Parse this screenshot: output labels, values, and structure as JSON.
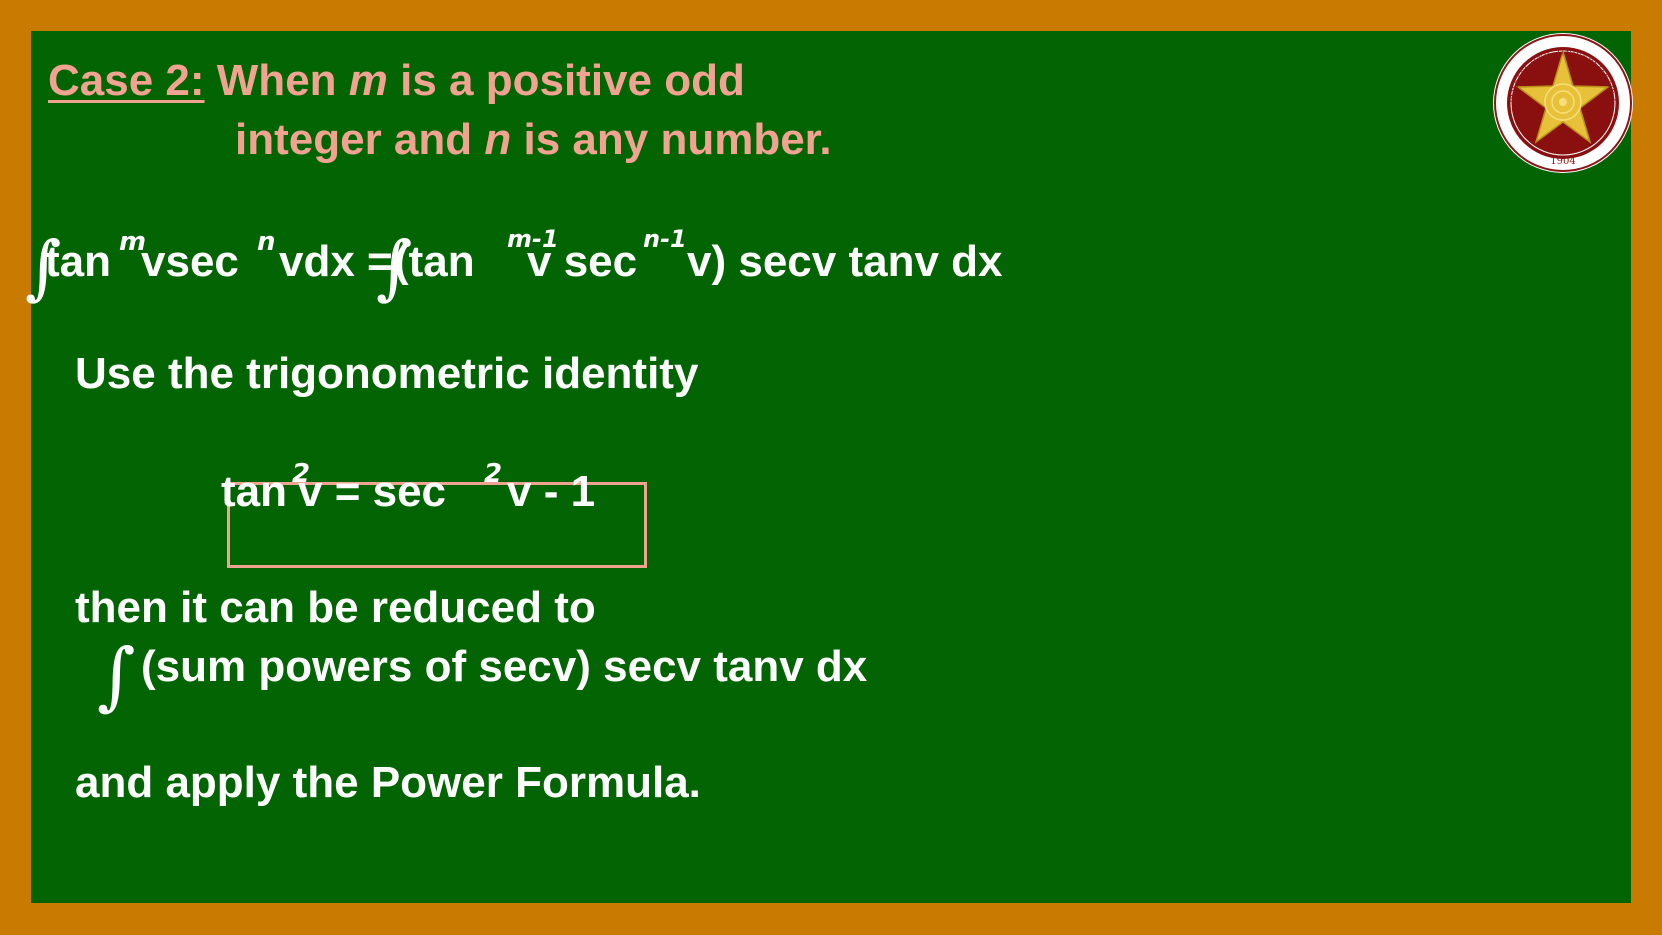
{
  "heading": {
    "case_label": "Case 2:",
    "line1_a": "When ",
    "var_m": "m",
    "line1_b": " is a positive odd",
    "line2_a": "integer and ",
    "var_n": "n",
    "line2_b": " is any number."
  },
  "formula": {
    "lhs_a": "tan",
    "lhs_exp1": "m",
    "lhs_b": "vsec",
    "lhs_exp2": "n",
    "lhs_c": "vdx =",
    "rhs_a": "(tan",
    "rhs_exp1": "m-1",
    "rhs_b": "v sec",
    "rhs_exp2": "n-1",
    "rhs_c": "v) secv tanv dx"
  },
  "text": {
    "use_identity": "Use the trigonometric identity",
    "reduced": "then it can be reduced to",
    "sum_powers": "(sum powers of secv) secv tanv dx",
    "apply": "and apply the Power Formula."
  },
  "identity": {
    "lhs": "tan",
    "exp1": "2",
    "mid": " v = sec",
    "exp2": "2",
    "rhs": "v - 1"
  },
  "logo": {
    "arc_text": "POLYTECHNIC UNIVERSITY OF THE PHILIPPINES",
    "year": "1904"
  },
  "colors": {
    "frame": "#c97a00",
    "board": "#026402",
    "accent": "#f0a390",
    "text": "#ffffff"
  }
}
